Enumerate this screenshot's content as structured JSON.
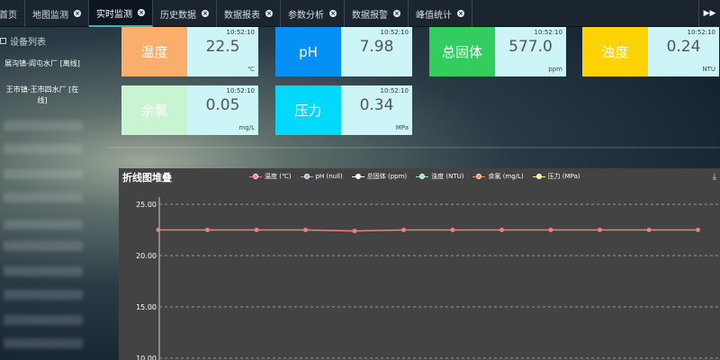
{
  "tabs": [
    {
      "label": "首页",
      "active": false,
      "closable": false
    },
    {
      "label": "地图监测",
      "active": false,
      "closable": true
    },
    {
      "label": "实时监测",
      "active": true,
      "closable": true
    },
    {
      "label": "历史数据",
      "active": false,
      "closable": true
    },
    {
      "label": "数据报表",
      "active": false,
      "closable": true
    },
    {
      "label": "参数分析",
      "active": false,
      "closable": true
    },
    {
      "label": "数据报警",
      "active": false,
      "closable": true
    },
    {
      "label": "峰值统计",
      "active": false,
      "closable": true
    }
  ],
  "tab_more_glyph": "▶▶",
  "sidebar": {
    "title": "设备列表",
    "devices": [
      "展沟镇-阎屯水厂 [离线]",
      "王市镇-王市四水厂 [在线]"
    ]
  },
  "cards": [
    {
      "name": "温度",
      "time": "10:52:10",
      "value": "22.5",
      "unit": "℃",
      "color": "#fbad6c"
    },
    {
      "name": "pH",
      "time": "10:52:10",
      "value": "7.98",
      "unit": "",
      "color": "#0590f5"
    },
    {
      "name": "总固体",
      "time": "10:52:10",
      "value": "577.0",
      "unit": "ppm",
      "color": "#33cc5e"
    },
    {
      "name": "浊度",
      "time": "10:52:10",
      "value": "0.24",
      "unit": "NTU",
      "color": "#fed306"
    },
    {
      "name": "余氯",
      "time": "10:52:10",
      "value": "0.05",
      "unit": "mg/L",
      "color": "#c9f4d2"
    },
    {
      "name": "压力",
      "time": "10:52:10",
      "value": "0.34",
      "unit": "MPa",
      "color": "#00d8fc"
    }
  ],
  "chart_data": {
    "type": "line",
    "title": "折线图堆叠",
    "legend": [
      {
        "name": "温度 (℃)",
        "color": "#f08080"
      },
      {
        "name": "pH (null)",
        "color": "#8fb7c2"
      },
      {
        "name": "总固体 (ppm)",
        "color": "#ffffff"
      },
      {
        "name": "浊度 (NTU)",
        "color": "#9fe0c0"
      },
      {
        "name": "余氯 (mg/L)",
        "color": "#ff8a60"
      },
      {
        "name": "压力 (MPa)",
        "color": "#ffee88"
      }
    ],
    "y_ticks": [
      "25.00",
      "20.00",
      "15.00",
      "10.00"
    ],
    "ylim": [
      10,
      25
    ],
    "grid": true,
    "series": [
      {
        "name": "温度 (℃)",
        "color": "#f08080",
        "values": [
          22.5,
          22.5,
          22.5,
          22.5,
          22.4,
          22.5,
          22.5,
          22.5,
          22.5,
          22.5,
          22.5,
          22.5
        ]
      }
    ]
  },
  "download_icon_glyph": "⤓"
}
